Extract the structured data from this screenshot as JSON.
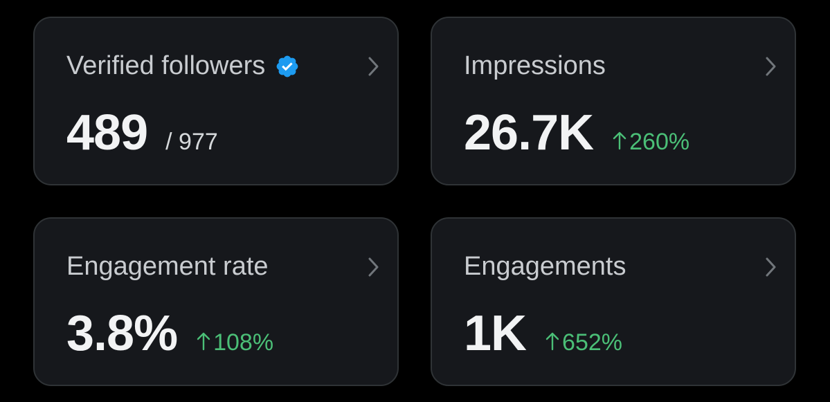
{
  "cards": [
    {
      "title": "Verified followers",
      "value": "489",
      "sub_value": "/ 977"
    },
    {
      "title": "Impressions",
      "value": "26.7K",
      "change": "260%"
    },
    {
      "title": "Engagement rate",
      "value": "3.8%",
      "change": "108%"
    },
    {
      "title": "Engagements",
      "value": "1K",
      "change": "652%"
    }
  ],
  "icons": {
    "verified": "verified-badge-icon",
    "chevron": "chevron-right-icon",
    "arrow": "arrow-up-icon"
  },
  "colors": {
    "background": "#000000",
    "card": "#16181c",
    "card_border": "#2f3336",
    "positive": "#4bbf77",
    "verified_badge": "#1d9bf0"
  }
}
